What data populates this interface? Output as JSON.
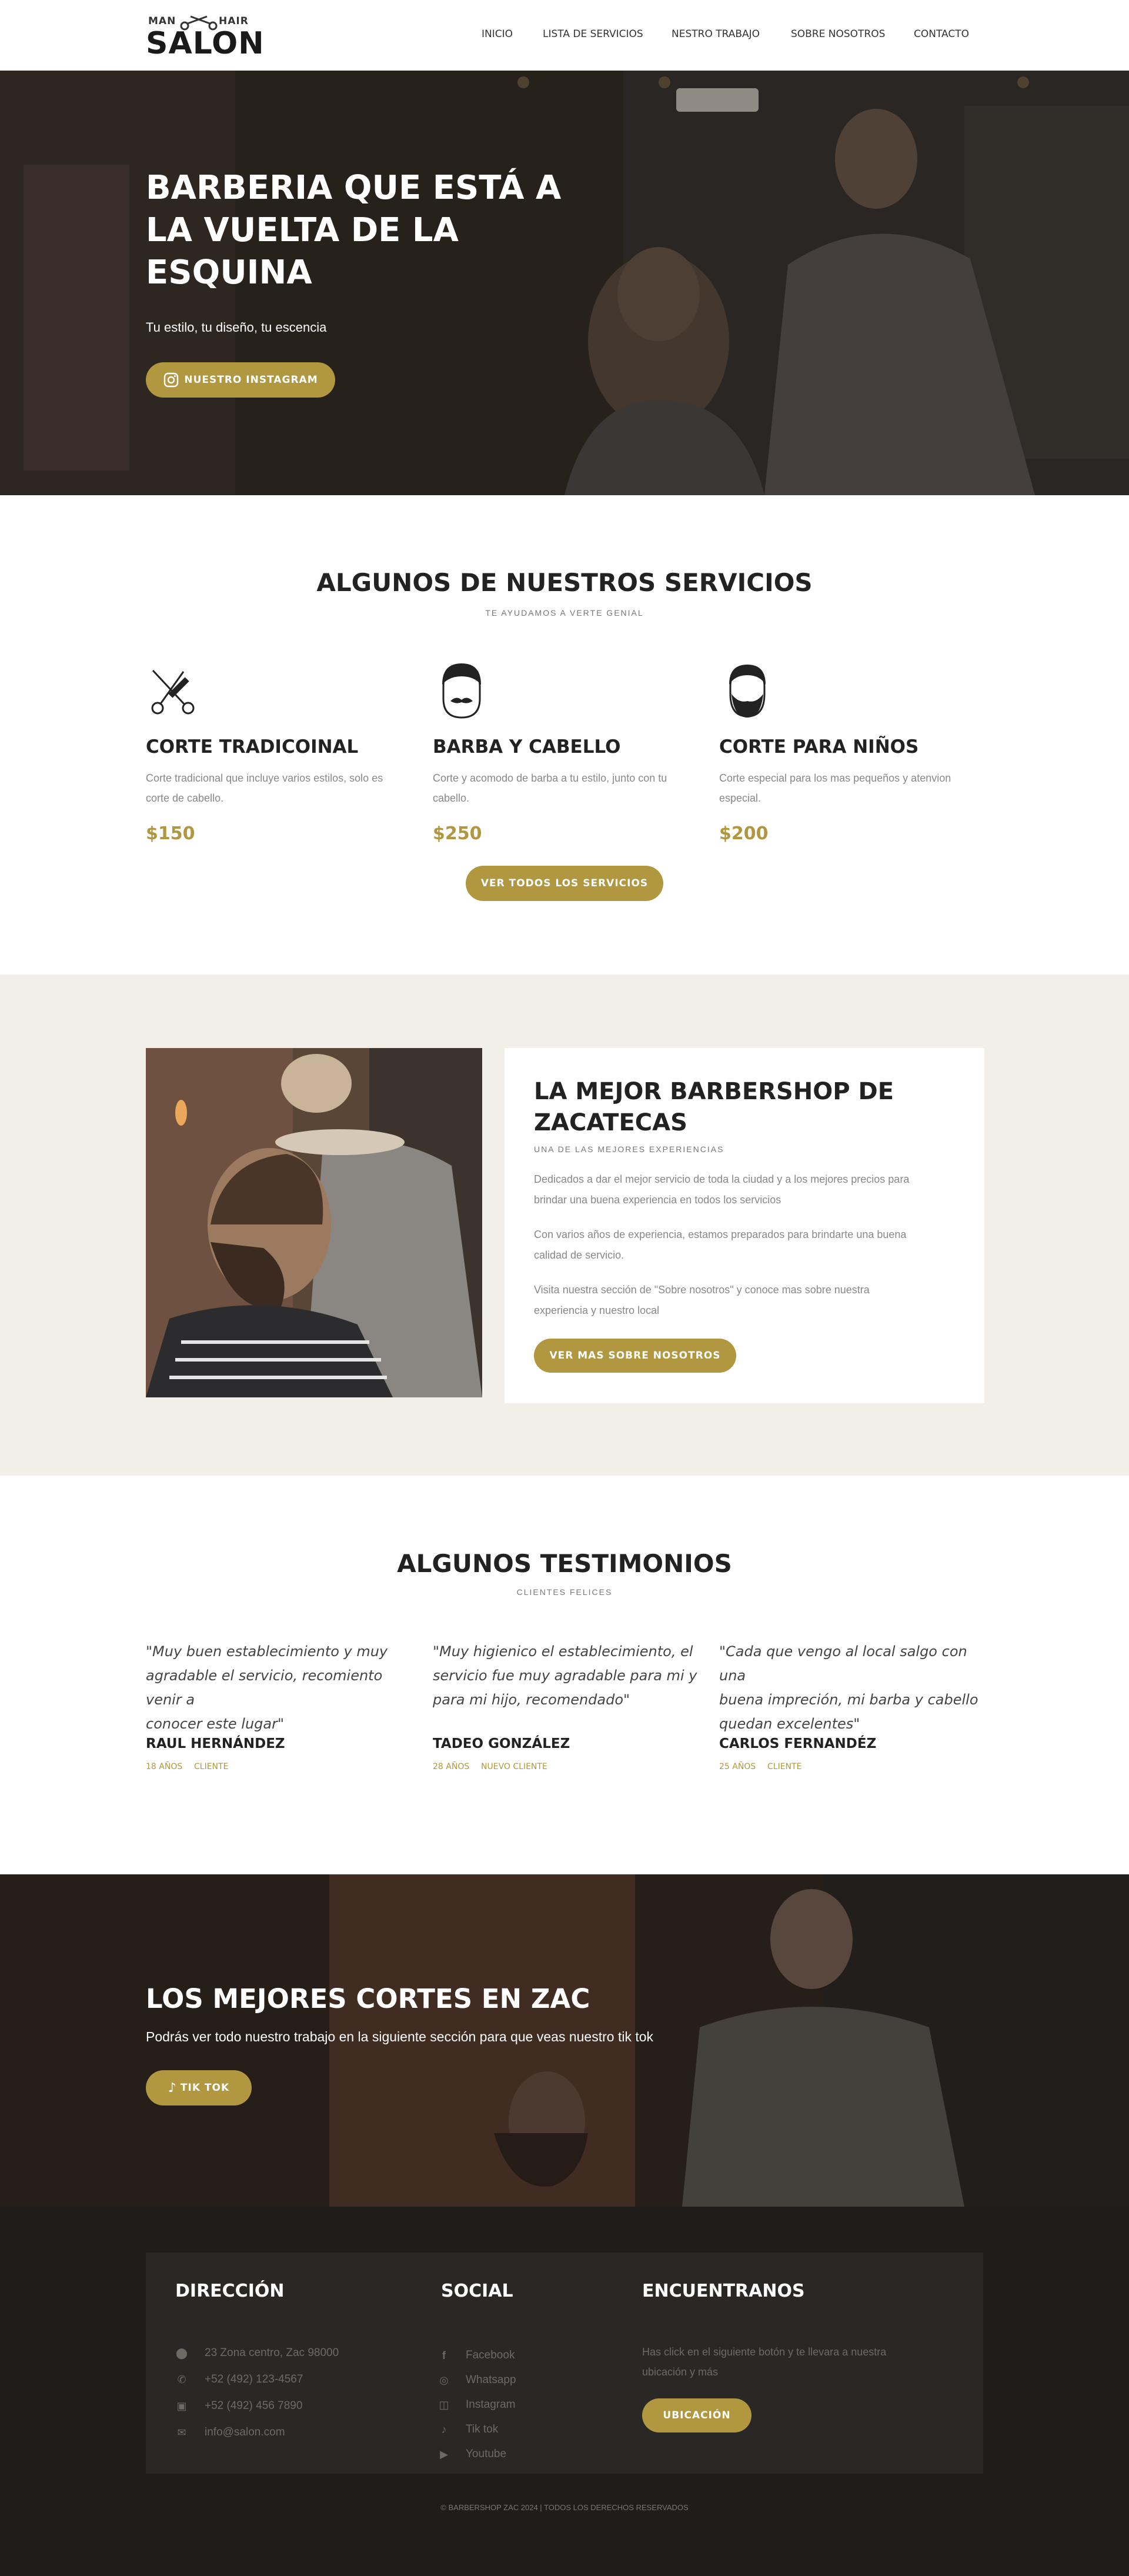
{
  "header": {
    "logo_top_left": "MAN",
    "logo_top_right": "HAIR",
    "logo_main": "SALON",
    "nav": [
      "INICIO",
      "LISTA DE SERVICIOS",
      "NESTRO TRABAJO",
      "SOBRE NOSOTROS",
      "CONTACTO"
    ]
  },
  "hero": {
    "title_lines": [
      "BARBERIA QUE ESTÁ A",
      "LA VUELTA DE LA",
      "ESQUINA"
    ],
    "subtitle": "Tu estilo, tu diseño, tu escencia",
    "button": "NUESTRO INSTAGRAM"
  },
  "services": {
    "title": "ALGUNOS DE NUESTROS SERVICIOS",
    "subtitle": "TE AYUDAMOS A VERTE GENIAL",
    "items": [
      {
        "icon": "scissors-comb-icon",
        "name": "CORTE TRADICOINAL",
        "desc_lines": [
          "Corte tradicional que incluye varios estilos, solo es",
          "corte de cabello."
        ],
        "price": "$150"
      },
      {
        "icon": "mustache-face-icon",
        "name": "BARBA Y CABELLO",
        "desc_lines": [
          "Corte y acomodo de barba a tu estilo, junto con tu",
          "cabello."
        ],
        "price": "$250"
      },
      {
        "icon": "bearded-face-icon",
        "name": "CORTE PARA NIÑOS",
        "desc_lines": [
          "Corte especial para los mas pequeños y atenvion",
          "especial."
        ],
        "price": "$200"
      }
    ],
    "button": "VER TODOS LOS SERVICIOS"
  },
  "about": {
    "title_lines": [
      "LA MEJOR BARBERSHOP DE",
      "ZACATECAS"
    ],
    "subtitle": "UNA DE LAS MEJORES EXPERIENCIAS",
    "paragraphs": [
      [
        "Dedicados a dar el mejor servicio de toda la ciudad y a los mejores precios para",
        "brindar una buena experiencia en todos los servicios"
      ],
      [
        "Con varios años de experiencia, estamos preparados para brindarte una buena",
        "calidad de servicio."
      ],
      [
        "Visita nuestra sección de \"Sobre nosotros\" y conoce mas sobre nuestra",
        "experiencia y nuestro local"
      ]
    ],
    "button": "VER MAS SOBRE NOSOTROS"
  },
  "testimonials": {
    "title": "ALGUNOS TESTIMONIOS",
    "subtitle": "CLIENTES FELICES",
    "items": [
      {
        "quote_lines": [
          "\"Muy buen establecimiento y muy",
          "agradable el servicio, recomiento venir a",
          "conocer este lugar\""
        ],
        "name": "RAUL HERNÁNDEZ",
        "age": "18 AÑOS",
        "role": "CLIENTE"
      },
      {
        "quote_lines": [
          "\"Muy higienico el establecimiento, el",
          "servicio fue muy agradable para mi y",
          "para mi hijo, recomendado\""
        ],
        "name": "TADEO GONZÁLEZ",
        "age": "28 AÑOS",
        "role": "NUEVO CLIENTE"
      },
      {
        "quote_lines": [
          "\"Cada que vengo al local salgo con una",
          "buena impreción, mi barba y cabello",
          "quedan excelentes\""
        ],
        "name": "CARLOS FERNANDÉZ",
        "age": "25 AÑOS",
        "role": "CLIENTE"
      }
    ]
  },
  "cta": {
    "title": "LOS MEJORES CORTES EN ZAC",
    "subtitle": "Podrás ver todo nuestro trabajo en la siguiente sección para que veas nuestro tik tok",
    "button": "TIK TOK"
  },
  "footer": {
    "address": {
      "heading": "DIRECCIÓN",
      "items": [
        {
          "icon": "map-pin-icon",
          "text": "23 Zona centro, Zac 98000"
        },
        {
          "icon": "phone-icon",
          "text": "+52 (492) 123-4567"
        },
        {
          "icon": "fax-icon",
          "text": "+52 (492) 456 7890"
        },
        {
          "icon": "envelope-icon",
          "text": "info@salon.com"
        }
      ]
    },
    "social": {
      "heading": "SOCIAL",
      "items": [
        {
          "icon": "facebook-icon",
          "text": "Facebook"
        },
        {
          "icon": "whatsapp-icon",
          "text": "Whatsapp"
        },
        {
          "icon": "instagram-icon",
          "text": "Instagram"
        },
        {
          "icon": "tiktok-icon",
          "text": "Tik tok"
        },
        {
          "icon": "youtube-icon",
          "text": "Youtube"
        }
      ]
    },
    "find": {
      "heading": "ENCUENTRANOS",
      "text_lines": [
        "Has click en el siguiente botón y te llevara a nuestra",
        "ubicación y más"
      ],
      "button": "UBICACIÓN"
    },
    "copyright": "© BARBERSHOP ZAC 2024 | TODOS LOS DERECHOS RESERVADOS"
  },
  "colors": {
    "accent": "#b1973f",
    "about_bg": "#f2efe9",
    "footer_bg": "#1f1d1b"
  }
}
